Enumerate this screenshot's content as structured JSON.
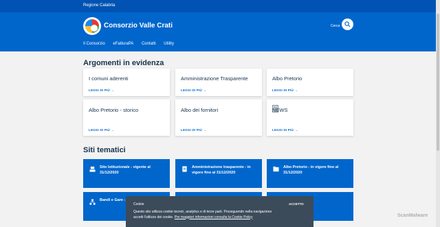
{
  "topbar": {
    "label": "Regione Calabria"
  },
  "header": {
    "site_title": "Consorzio Valle Crati",
    "search_label": "Cerca",
    "nav": [
      "Il Consorzio",
      "eFatturaPA",
      "Contatti",
      "Utility"
    ]
  },
  "highlights": {
    "title": "Argomenti in evidenza",
    "more_label": "LEGGI DI PIÙ",
    "cards": [
      {
        "title": "I comuni aderenti"
      },
      {
        "title": "Amministrazione Trasparente"
      },
      {
        "title": "Albo Pretorio"
      },
      {
        "title": "Albo Pretorio - storico"
      },
      {
        "title": "Albo dei fornitori"
      },
      {
        "title": "NEWS",
        "icon": "document-icon"
      }
    ]
  },
  "themes": {
    "title": "Siti tematici",
    "cards": [
      {
        "title": "Sito Istituzionale - vigente al 31/12/2020",
        "icon": "building-icon"
      },
      {
        "title": "Amministrazione trasparente - in vigore fino al 31/12/2020",
        "icon": "document-icon"
      },
      {
        "title": "Albo Pretorio - in vigore fino al 31/12/2020",
        "icon": "folder-icon"
      },
      {
        "title": "Bandi e Gare - fino al 31/12/2019",
        "icon": "org-chart-icon"
      }
    ]
  },
  "cookie": {
    "title": "Cookie",
    "text": "Questo sito utilizza cookie tecnici, analytics e di terze parti. Proseguendo nella navigazione accetti l'utilizzo dei cookie.",
    "link": "Per maggiori informazioni consulta la Cookie Policy",
    "accept": "ACCETTO"
  },
  "watermark": "ScanMalware",
  "colors": {
    "primary": "#0066cc",
    "topbar": "#0053b3",
    "text": "#17324d",
    "cookie_bg": "#3b4b5a"
  }
}
